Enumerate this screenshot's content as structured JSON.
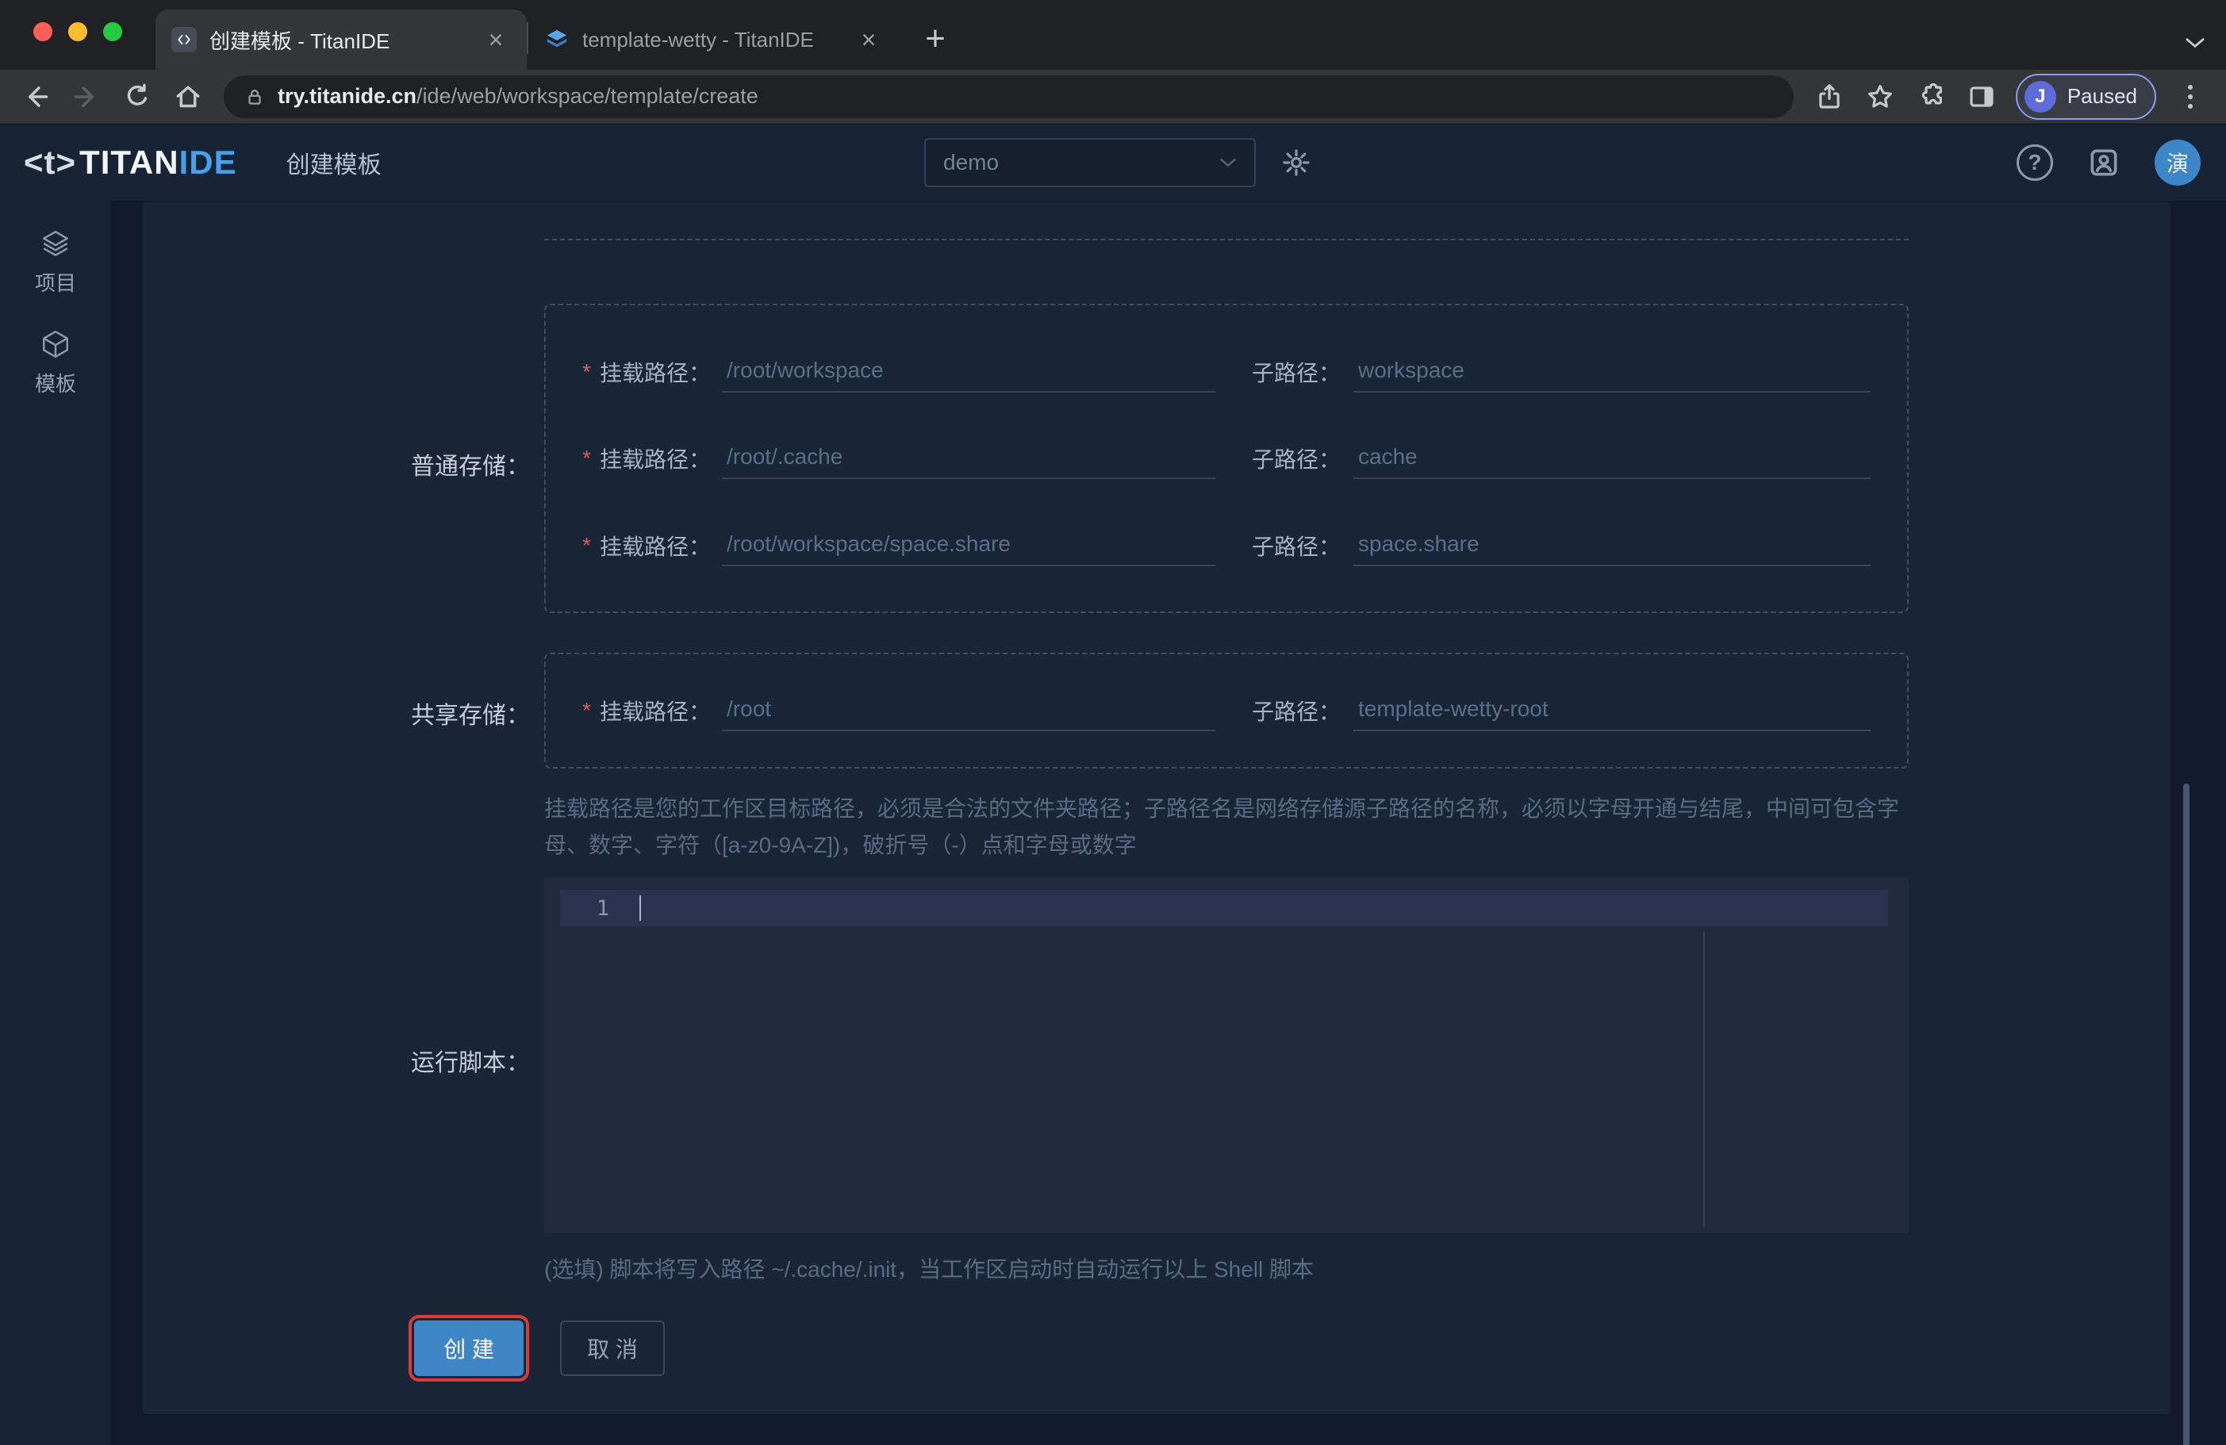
{
  "browser": {
    "tabs": [
      {
        "title": "创建模板 - TitanIDE"
      },
      {
        "title": "template-wetty - TitanIDE"
      }
    ],
    "new_tab_glyph": "+",
    "close_glyph": "×",
    "url_host": "try.titanide.cn",
    "url_path": "/ide/web/workspace/template/create",
    "profile": {
      "initial": "J",
      "status": "Paused"
    }
  },
  "header": {
    "logo_mark": "<t>",
    "logo_main": "TITAN",
    "logo_accent": "IDE",
    "page_title": "创建模板",
    "workspace_value": "demo",
    "help_glyph": "?",
    "avatar_text": "演"
  },
  "sidebar": {
    "items": [
      {
        "label": "项目"
      },
      {
        "label": "模板"
      }
    ]
  },
  "form": {
    "normal_storage": {
      "section_label": "普通存储：",
      "rows": [
        {
          "required": "*",
          "mount_label": "挂载路径：",
          "mount_value": "/root/workspace",
          "sub_label": "子路径：",
          "sub_value": "workspace"
        },
        {
          "required": "*",
          "mount_label": "挂载路径：",
          "mount_value": "/root/.cache",
          "sub_label": "子路径：",
          "sub_value": "cache"
        },
        {
          "required": "*",
          "mount_label": "挂载路径：",
          "mount_value": "/root/workspace/space.share",
          "sub_label": "子路径：",
          "sub_value": "space.share"
        }
      ]
    },
    "shared_storage": {
      "section_label": "共享存储：",
      "rows": [
        {
          "required": "*",
          "mount_label": "挂载路径：",
          "mount_value": "/root",
          "sub_label": "子路径：",
          "sub_value": "template-wetty-root"
        }
      ]
    },
    "path_hint": "挂载路径是您的工作区目标路径，必须是合法的文件夹路径；子路径名是网络存储源子路径的名称，必须以字母开通与结尾，中间可包含字母、数字、字符（[a-z0-9A-Z])，破折号（-）点和字母或数字",
    "script": {
      "section_label": "运行脚本：",
      "line_number": "1",
      "hint": "(选填) 脚本将写入路径 ~/.cache/.init，当工作区启动时自动运行以上 Shell 脚本"
    },
    "buttons": {
      "create": "创 建",
      "cancel": "取 消"
    }
  },
  "icons": {
    "used": [
      "code-favicon-icon",
      "layers-favicon-icon",
      "back-icon",
      "forward-icon",
      "reload-icon",
      "home-icon",
      "lock-icon",
      "share-icon",
      "star-icon",
      "extensions-puzzle-icon",
      "side-panel-icon",
      "menu-dots-icon",
      "chevron-down-icon",
      "gear-icon",
      "question-icon",
      "help-center-icon",
      "layers-icon",
      "cube-icon"
    ]
  },
  "colors": {
    "accent_blue": "#3e86c6",
    "logo_accent": "#47a0e8",
    "required_red": "#e25a52",
    "highlight_ring": "#d93a3a"
  }
}
